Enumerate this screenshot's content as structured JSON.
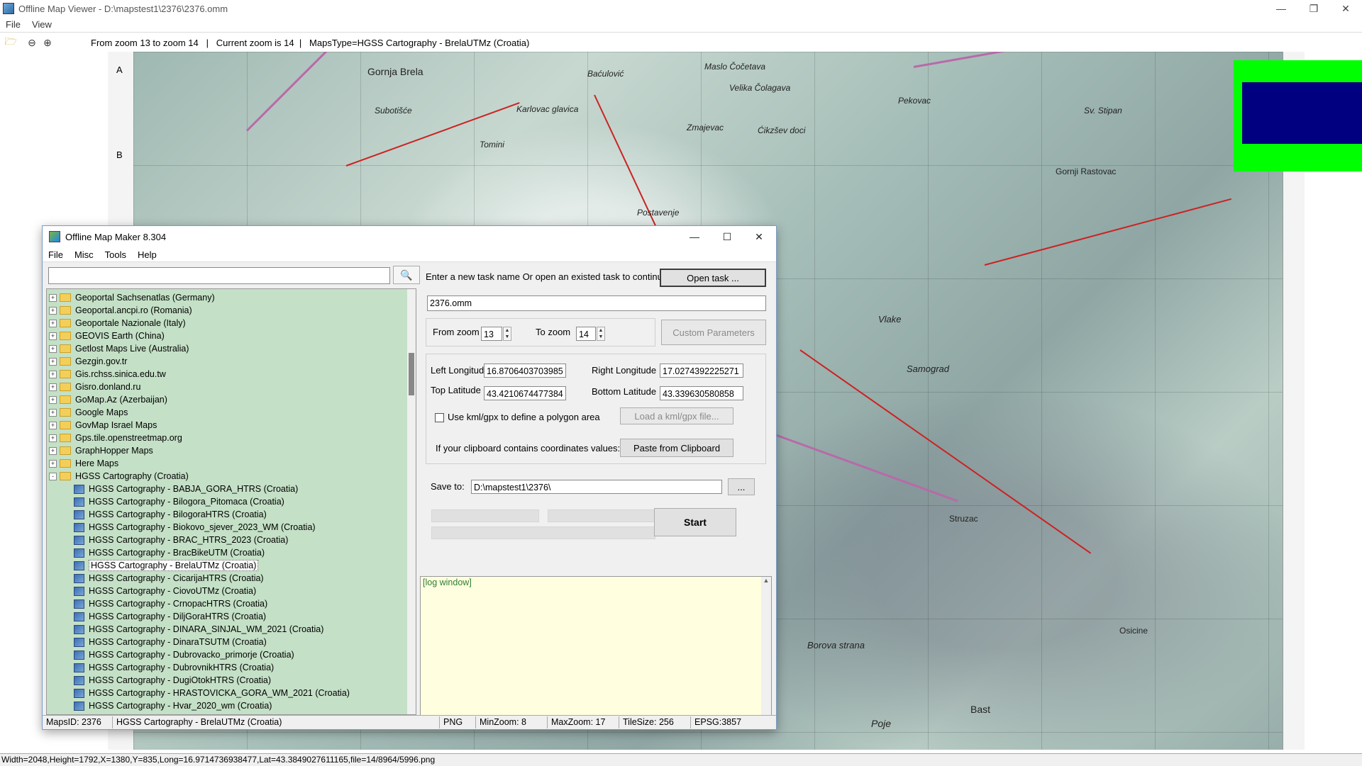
{
  "viewer": {
    "title": "Offline Map Viewer - D:\\mapstest1\\2376\\2376.omm",
    "menu": [
      "File",
      "View"
    ],
    "toolbar_info": "From zoom 13 to zoom 14   |   Current zoom is 14  |   MapsType=HGSS Cartography - BrelaUTMz (Croatia)",
    "side_letters": [
      "A",
      "B"
    ],
    "status": "Width=2048,Height=1792,X=1380,Y=835,Long=16.9714736938477,Lat=43.3849027611165,file=14/8964/5996.png"
  },
  "map_labels": [
    "Gornja Brela",
    "Subotišće",
    "Baćulović",
    "Maslo Čočetava",
    "Velika Čolagava",
    "Ćikzšev doci",
    "Pekovac",
    "Sv. Stipan",
    "Gornji Rastovac",
    "Postavenje",
    "Samograd",
    "Vlake",
    "Struzac",
    "Borova strana",
    "Bast",
    "Poje",
    "Osicine",
    "Tomini",
    "Karlovac glavica",
    "Zmajevac"
  ],
  "dialog": {
    "title": "Offline Map Maker 8.304",
    "menu": [
      "File",
      "Misc",
      "Tools",
      "Help"
    ],
    "search_value": "",
    "tree": [
      {
        "label": "Geoportal Sachsenatlas (Germany)",
        "type": "folder",
        "expander": "+"
      },
      {
        "label": "Geoportal.ancpi.ro (Romania)",
        "type": "folder",
        "expander": "+"
      },
      {
        "label": "Geoportale Nazionale (Italy)",
        "type": "folder",
        "expander": "+"
      },
      {
        "label": "GEOVIS Earth (China)",
        "type": "folder",
        "expander": "+"
      },
      {
        "label": "Getlost Maps Live (Australia)",
        "type": "folder",
        "expander": "+"
      },
      {
        "label": "Gezgin.gov.tr",
        "type": "folder",
        "expander": "+"
      },
      {
        "label": "Gis.rchss.sinica.edu.tw",
        "type": "folder",
        "expander": "+"
      },
      {
        "label": "Gisro.donland.ru",
        "type": "folder",
        "expander": "+"
      },
      {
        "label": "GoMap.Az (Azerbaijan)",
        "type": "folder",
        "expander": "+"
      },
      {
        "label": "Google Maps",
        "type": "folder",
        "expander": "+"
      },
      {
        "label": "GovMap Israel Maps",
        "type": "folder",
        "expander": "+"
      },
      {
        "label": "Gps.tile.openstreetmap.org",
        "type": "folder",
        "expander": "+"
      },
      {
        "label": "GraphHopper Maps",
        "type": "folder",
        "expander": "+"
      },
      {
        "label": "Here Maps",
        "type": "folder",
        "expander": "+"
      },
      {
        "label": "HGSS Cartography (Croatia)",
        "type": "folder",
        "expander": "-"
      },
      {
        "label": "HGSS Cartography - BABJA_GORA_HTRS (Croatia)",
        "type": "map"
      },
      {
        "label": "HGSS Cartography - Bilogora_Pitomaca (Croatia)",
        "type": "map"
      },
      {
        "label": "HGSS Cartography - BilogoraHTRS (Croatia)",
        "type": "map"
      },
      {
        "label": "HGSS Cartography - Biokovo_sjever_2023_WM (Croatia)",
        "type": "map"
      },
      {
        "label": "HGSS Cartography - BRAC_HTRS_2023 (Croatia)",
        "type": "map"
      },
      {
        "label": "HGSS Cartography - BracBikeUTM (Croatia)",
        "type": "map"
      },
      {
        "label": "HGSS Cartography - BrelaUTMz (Croatia)",
        "type": "map",
        "selected": true
      },
      {
        "label": "HGSS Cartography - CicarijaHTRS (Croatia)",
        "type": "map"
      },
      {
        "label": "HGSS Cartography - CiovoUTMz (Croatia)",
        "type": "map"
      },
      {
        "label": "HGSS Cartography - CrnopacHTRS (Croatia)",
        "type": "map"
      },
      {
        "label": "HGSS Cartography - DiljGoraHTRS (Croatia)",
        "type": "map"
      },
      {
        "label": "HGSS Cartography - DINARA_SINJAL_WM_2021 (Croatia)",
        "type": "map"
      },
      {
        "label": "HGSS Cartography - DinaraTSUTM (Croatia)",
        "type": "map"
      },
      {
        "label": "HGSS Cartography - Dubrovacko_primorje (Croatia)",
        "type": "map"
      },
      {
        "label": "HGSS Cartography - DubrovnikHTRS (Croatia)",
        "type": "map"
      },
      {
        "label": "HGSS Cartography - DugiOtokHTRS (Croatia)",
        "type": "map"
      },
      {
        "label": "HGSS Cartography - HRASTOVICKA_GORA_WM_2021 (Croatia)",
        "type": "map"
      },
      {
        "label": "HGSS Cartography - Hvar_2020_wm (Croatia)",
        "type": "map"
      }
    ],
    "task_prompt": "Enter a new task name Or open an existed task to continue:",
    "open_task_btn": "Open task ...",
    "task_name": "2376.omm",
    "from_zoom_label": "From zoom",
    "from_zoom": "13",
    "to_zoom_label": "To zoom",
    "to_zoom": "14",
    "custom_params_btn": "Custom Parameters",
    "left_lon_label": "Left Longitude",
    "left_lon": "16.8706403703985",
    "right_lon_label": "Right Longitude",
    "right_lon": "17.0274392225271",
    "top_lat_label": "Top Latitude",
    "top_lat": "43.4210674477384",
    "bottom_lat_label": "Bottom Latitude",
    "bottom_lat": "43.3396305808​58",
    "kml_label": "Use kml/gpx to define a polygon area",
    "load_kml_btn": "Load a kml/gpx file...",
    "clipboard_label": "If your clipboard contains coordinates values:",
    "paste_btn": "Paste from Clipboard",
    "save_to_label": "Save to:",
    "save_to": "D:\\mapstest1\\2376\\",
    "browse_btn": "...",
    "start_btn": "Start",
    "log_text": "[log window]",
    "status": {
      "maps_id": "MapsID: 2376",
      "maps_name": "HGSS Cartography - BrelaUTMz (Croatia)",
      "format": "PNG",
      "min_zoom": "MinZoom: 8",
      "max_zoom": "MaxZoom: 17",
      "tile_size": "TileSize: 256",
      "epsg": "EPSG:3857"
    }
  },
  "colors": {
    "overlay_green": "#00ff00",
    "overlay_blue": "#000080",
    "tree_bg": "#c4e0c6",
    "log_bg": "#ffffe0"
  }
}
